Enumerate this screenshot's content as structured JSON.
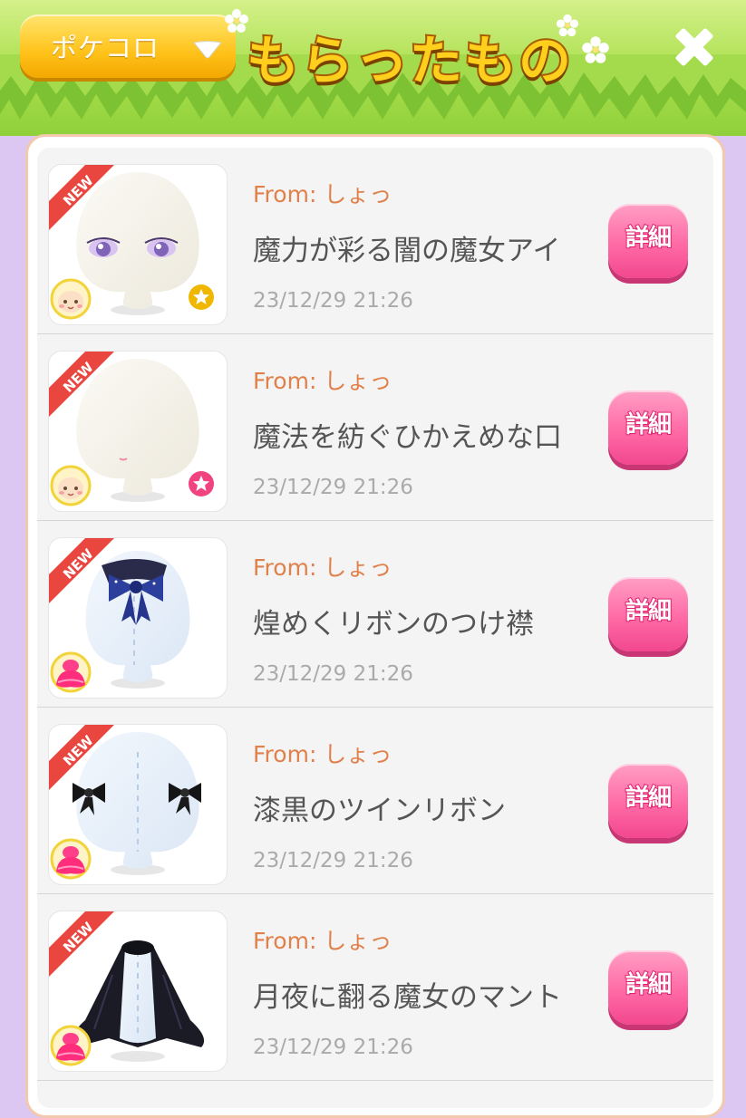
{
  "header": {
    "dropdown_label": "ポケコロ",
    "title": "もらったもの",
    "close_icon": "close-x-icon",
    "colors": {
      "title_fill": "#ffcf1d",
      "grass": "#8fd03a",
      "dropdown": "#ffc21a"
    }
  },
  "gifts": [
    {
      "from": "From: しょっ",
      "name": "魔力が彩る闇の魔女アイ",
      "date": "23/12/29 21:26",
      "badge": "NEW",
      "detail": "詳細",
      "category_icon": "face-icon",
      "rarity_icon": "gold-star-icon"
    },
    {
      "from": "From: しょっ",
      "name": "魔法を紡ぐひかえめな口",
      "date": "23/12/29 21:26",
      "badge": "NEW",
      "detail": "詳細",
      "category_icon": "face-icon",
      "rarity_icon": "pink-star-icon"
    },
    {
      "from": "From: しょっ",
      "name": "煌めくリボンのつけ襟",
      "date": "23/12/29 21:26",
      "badge": "NEW",
      "detail": "詳細",
      "category_icon": "dress-icon",
      "rarity_icon": ""
    },
    {
      "from": "From: しょっ",
      "name": "漆黒のツインリボン",
      "date": "23/12/29 21:26",
      "badge": "NEW",
      "detail": "詳細",
      "category_icon": "dress-icon",
      "rarity_icon": ""
    },
    {
      "from": "From: しょっ",
      "name": "月夜に翻る魔女のマント",
      "date": "23/12/29 21:26",
      "badge": "NEW",
      "detail": "詳細",
      "category_icon": "dress-icon",
      "rarity_icon": ""
    }
  ],
  "colors": {
    "background": "#dcc6f2",
    "accent_text": "#e0804a",
    "detail_button": "#ff6aa5"
  }
}
